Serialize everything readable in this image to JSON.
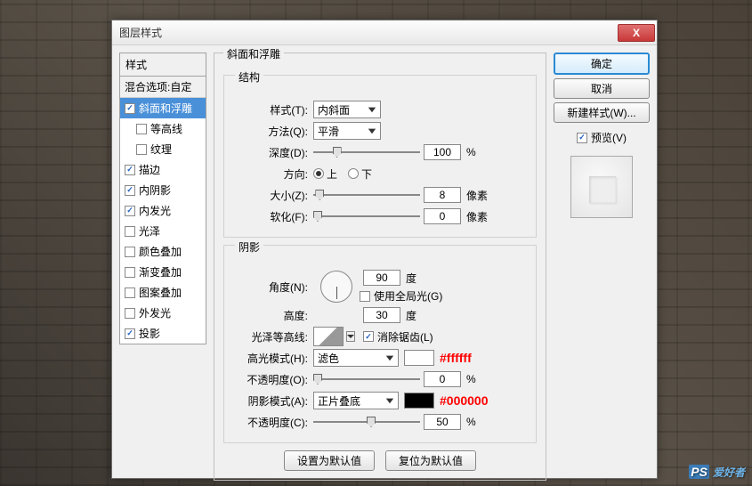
{
  "dialog": {
    "title": "图层样式"
  },
  "left": {
    "header": "样式",
    "blend": "混合选项:自定",
    "items": [
      {
        "label": "斜面和浮雕",
        "checked": true,
        "selected": true,
        "nested": false
      },
      {
        "label": "等高线",
        "checked": false,
        "selected": false,
        "nested": true
      },
      {
        "label": "纹理",
        "checked": false,
        "selected": false,
        "nested": true
      },
      {
        "label": "描边",
        "checked": true,
        "selected": false,
        "nested": false
      },
      {
        "label": "内阴影",
        "checked": true,
        "selected": false,
        "nested": false
      },
      {
        "label": "内发光",
        "checked": true,
        "selected": false,
        "nested": false
      },
      {
        "label": "光泽",
        "checked": false,
        "selected": false,
        "nested": false
      },
      {
        "label": "颜色叠加",
        "checked": false,
        "selected": false,
        "nested": false
      },
      {
        "label": "渐变叠加",
        "checked": false,
        "selected": false,
        "nested": false
      },
      {
        "label": "图案叠加",
        "checked": false,
        "selected": false,
        "nested": false
      },
      {
        "label": "外发光",
        "checked": false,
        "selected": false,
        "nested": false
      },
      {
        "label": "投影",
        "checked": true,
        "selected": false,
        "nested": false
      }
    ]
  },
  "main": {
    "group_title": "斜面和浮雕",
    "structure": {
      "legend": "结构",
      "style_label": "样式(T):",
      "style_value": "内斜面",
      "method_label": "方法(Q):",
      "method_value": "平滑",
      "depth_label": "深度(D):",
      "depth_value": "100",
      "depth_unit": "%",
      "direction_label": "方向:",
      "dir_up": "上",
      "dir_down": "下",
      "size_label": "大小(Z):",
      "size_value": "8",
      "size_unit": "像素",
      "soften_label": "软化(F):",
      "soften_value": "0",
      "soften_unit": "像素"
    },
    "shading": {
      "legend": "阴影",
      "angle_label": "角度(N):",
      "angle_value": "90",
      "angle_unit": "度",
      "global_light": "使用全局光(G)",
      "altitude_label": "高度:",
      "altitude_value": "30",
      "altitude_unit": "度",
      "gloss_label": "光泽等高线:",
      "antialias": "消除锯齿(L)",
      "highlight_mode_label": "高光模式(H):",
      "highlight_mode_value": "滤色",
      "highlight_swatch": "#ffffff",
      "highlight_annot": "#ffffff",
      "highlight_opacity_label": "不透明度(O):",
      "highlight_opacity_value": "0",
      "highlight_opacity_unit": "%",
      "shadow_mode_label": "阴影模式(A):",
      "shadow_mode_value": "正片叠底",
      "shadow_swatch": "#000000",
      "shadow_annot": "#000000",
      "shadow_opacity_label": "不透明度(C):",
      "shadow_opacity_value": "50",
      "shadow_opacity_unit": "%"
    },
    "buttons": {
      "default": "设置为默认值",
      "reset": "复位为默认值"
    }
  },
  "right": {
    "ok": "确定",
    "cancel": "取消",
    "new_style": "新建样式(W)...",
    "preview": "预览(V)"
  },
  "watermark": {
    "ps": "PS",
    "text": "爱好者"
  }
}
